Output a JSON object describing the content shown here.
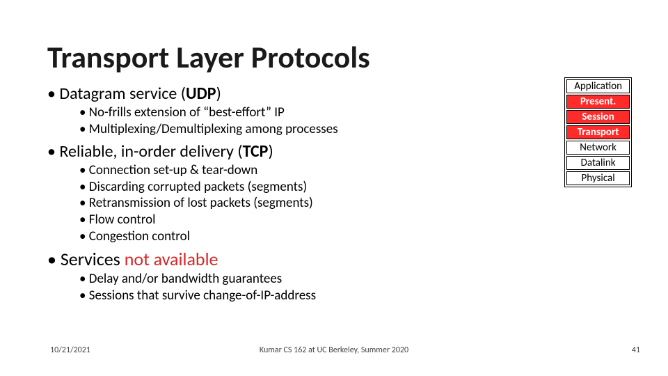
{
  "title": "Transport Layer Protocols",
  "body": {
    "b1": {
      "pre": "Datagram service (",
      "bold": "UDP",
      "post": ")"
    },
    "b1s": [
      "No-frills extension of “best-effort” IP",
      "Multiplexing/Demultiplexing among processes"
    ],
    "b2": {
      "pre": "Reliable, in-order delivery (",
      "bold": "TCP",
      "post": ")"
    },
    "b2s": [
      "Connection set-up & tear-down",
      "Discarding corrupted packets (segments)",
      "Retransmission of lost packets (segments)",
      "Flow control",
      "Congestion control"
    ],
    "b3": {
      "pre": "Services ",
      "red": "not available"
    },
    "b3s": [
      "Delay and/or bandwidth guarantees",
      "Sessions that survive change-of-IP-address"
    ]
  },
  "layers": [
    {
      "label": "Application",
      "hl": false
    },
    {
      "label": "Present.",
      "hl": true
    },
    {
      "label": "Session",
      "hl": true
    },
    {
      "label": "Transport",
      "hl": true
    },
    {
      "label": "Network",
      "hl": false
    },
    {
      "label": "Datalink",
      "hl": false
    },
    {
      "label": "Physical",
      "hl": false
    }
  ],
  "footer": {
    "date": "10/21/2021",
    "center": "Kumar CS 162 at UC Berkeley, Summer 2020",
    "num": "41"
  }
}
